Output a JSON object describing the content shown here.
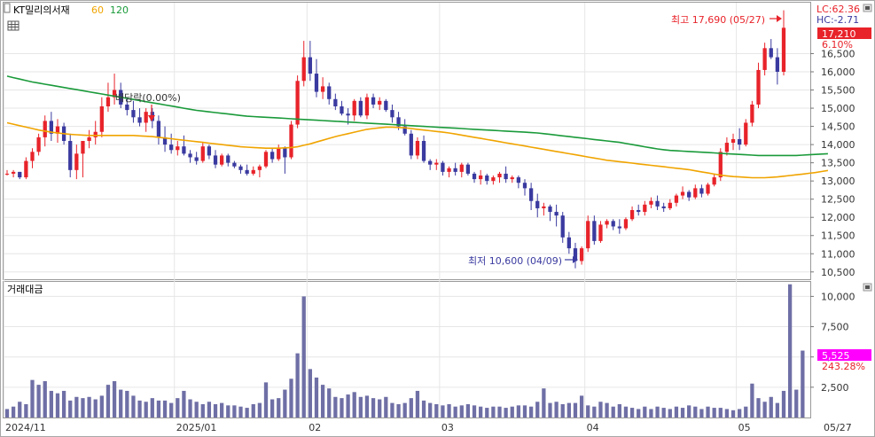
{
  "header": {
    "stock_name": "KT밀리의서재",
    "ma_short_label": "60",
    "ma_long_label": "120",
    "volume_title": "거래대금"
  },
  "indicators": {
    "lc": "LC:62.36",
    "hc": "HC:-2.71",
    "current_price": "17,210",
    "current_change": "6.10%",
    "current_volume": "5,525",
    "volume_change": "243.28%"
  },
  "annotations": {
    "high": "최고 17,690 (05/27)",
    "low": "최저 10,600 (04/09)",
    "dividend": "배당락(0.00%)"
  },
  "colors": {
    "up": "#e8232a",
    "down": "#3a3aa0",
    "ma60": "#f0a400",
    "ma120": "#1a9a3a",
    "volume_bar": "#6f6fa6",
    "price_badge": "#e8232a",
    "volume_badge": "#ff00ff",
    "grid": "#e6e6e6"
  },
  "chart_data": {
    "type": "candlestick",
    "price_axis": {
      "min": 10300,
      "max": 17900,
      "ticks": [
        "10,500",
        "11,000",
        "11,500",
        "12,000",
        "12,500",
        "13,000",
        "13,500",
        "14,000",
        "14,500",
        "15,000",
        "15,500",
        "16,000",
        "16,500"
      ]
    },
    "volume_axis": {
      "min": 0,
      "max": 11200,
      "ticks": [
        "2,500",
        "5,000",
        "7,500",
        "10,000"
      ]
    },
    "x_labels": [
      "2024/11",
      "2025/01",
      "02",
      "03",
      "04",
      "05",
      "05/27"
    ],
    "x_label_index": [
      0,
      27,
      48,
      69,
      92,
      116,
      130
    ],
    "candles": [
      [
        13200,
        13300,
        13150,
        13200
      ],
      [
        13200,
        13300,
        13100,
        13250
      ],
      [
        13250,
        13250,
        13050,
        13100
      ],
      [
        13100,
        13650,
        13050,
        13550
      ],
      [
        13550,
        13900,
        13350,
        13800
      ],
      [
        13800,
        14300,
        13700,
        14200
      ],
      [
        14200,
        14800,
        13950,
        14650
      ],
      [
        14650,
        14900,
        14100,
        14300
      ],
      [
        14300,
        14700,
        14050,
        14500
      ],
      [
        14500,
        14600,
        14000,
        14100
      ],
      [
        14100,
        14300,
        13100,
        13300
      ],
      [
        13300,
        14000,
        13050,
        13750
      ],
      [
        13750,
        14000,
        13100,
        14100
      ],
      [
        14100,
        14400,
        13900,
        14200
      ],
      [
        14200,
        14650,
        14000,
        14350
      ],
      [
        14350,
        15300,
        14200,
        15050
      ],
      [
        15050,
        15700,
        14900,
        15300
      ],
      [
        15300,
        15950,
        15100,
        15500
      ],
      [
        15500,
        15700,
        15000,
        15100
      ],
      [
        15100,
        15300,
        14800,
        14950
      ],
      [
        14950,
        15200,
        14600,
        14750
      ],
      [
        14750,
        15000,
        14500,
        14600
      ],
      [
        14600,
        15000,
        14350,
        14900
      ],
      [
        14900,
        15000,
        14450,
        14650
      ],
      [
        14650,
        14800,
        14000,
        14200
      ],
      [
        14200,
        14500,
        13800,
        14000
      ],
      [
        14000,
        14300,
        13750,
        13850
      ],
      [
        13850,
        14100,
        13700,
        13950
      ],
      [
        13950,
        14250,
        13700,
        13750
      ],
      [
        13750,
        13850,
        13500,
        13650
      ],
      [
        13650,
        13800,
        13450,
        13550
      ],
      [
        13550,
        14050,
        13500,
        13950
      ],
      [
        13950,
        14000,
        13600,
        13700
      ],
      [
        13700,
        13850,
        13350,
        13450
      ],
      [
        13450,
        13750,
        13400,
        13700
      ],
      [
        13700,
        13750,
        13400,
        13500
      ],
      [
        13500,
        13550,
        13350,
        13400
      ],
      [
        13400,
        13450,
        13200,
        13300
      ],
      [
        13300,
        13450,
        13150,
        13200
      ],
      [
        13200,
        13400,
        13150,
        13300
      ],
      [
        13300,
        13450,
        13100,
        13400
      ],
      [
        13400,
        13850,
        13350,
        13800
      ],
      [
        13800,
        13900,
        13500,
        13600
      ],
      [
        13600,
        14000,
        13550,
        13900
      ],
      [
        13900,
        13950,
        13200,
        13650
      ],
      [
        13650,
        14650,
        13600,
        14550
      ],
      [
        14550,
        15900,
        14450,
        15750
      ],
      [
        15750,
        16850,
        15600,
        16400
      ],
      [
        16400,
        16850,
        15750,
        15950
      ],
      [
        15950,
        16350,
        15300,
        15450
      ],
      [
        15450,
        15850,
        15250,
        15600
      ],
      [
        15600,
        15700,
        15100,
        15250
      ],
      [
        15250,
        15400,
        14950,
        15050
      ],
      [
        15050,
        15200,
        14800,
        14850
      ],
      [
        14850,
        15000,
        14550,
        14800
      ],
      [
        14800,
        15250,
        14650,
        15200
      ],
      [
        15200,
        15300,
        14750,
        14800
      ],
      [
        14800,
        15400,
        14700,
        15300
      ],
      [
        15300,
        15400,
        15000,
        15100
      ],
      [
        15100,
        15300,
        14950,
        15200
      ],
      [
        15200,
        15250,
        14900,
        14950
      ],
      [
        14950,
        15100,
        14600,
        14750
      ],
      [
        14750,
        14900,
        14400,
        14500
      ],
      [
        14500,
        14700,
        14250,
        14300
      ],
      [
        14300,
        14400,
        13600,
        13700
      ],
      [
        13700,
        14200,
        13600,
        14100
      ],
      [
        14100,
        14250,
        13500,
        13550
      ],
      [
        13550,
        13600,
        13300,
        13450
      ],
      [
        13450,
        13600,
        13300,
        13500
      ],
      [
        13500,
        13550,
        13150,
        13250
      ],
      [
        13250,
        13400,
        13100,
        13350
      ],
      [
        13350,
        13500,
        13150,
        13250
      ],
      [
        13250,
        13500,
        13100,
        13450
      ],
      [
        13450,
        13500,
        13150,
        13200
      ],
      [
        13200,
        13250,
        12950,
        13050
      ],
      [
        13050,
        13300,
        12900,
        13150
      ],
      [
        13150,
        13200,
        12900,
        13000
      ],
      [
        13000,
        13150,
        12900,
        13100
      ],
      [
        13100,
        13250,
        12950,
        13200
      ],
      [
        13200,
        13400,
        12950,
        13050
      ],
      [
        13050,
        13150,
        12950,
        13100
      ],
      [
        13100,
        13150,
        12800,
        12950
      ],
      [
        12950,
        13050,
        12600,
        12800
      ],
      [
        12800,
        12950,
        12200,
        12450
      ],
      [
        12450,
        12650,
        12000,
        12250
      ],
      [
        12250,
        12400,
        12050,
        12300
      ],
      [
        12300,
        12350,
        11900,
        12150
      ],
      [
        12150,
        12350,
        11750,
        12050
      ],
      [
        12050,
        12150,
        11300,
        11450
      ],
      [
        11450,
        11600,
        11000,
        11150
      ],
      [
        11150,
        11300,
        10600,
        10800
      ],
      [
        10800,
        11200,
        10700,
        11150
      ],
      [
        11150,
        12050,
        11050,
        11900
      ],
      [
        11900,
        12050,
        11250,
        11350
      ],
      [
        11350,
        11900,
        11300,
        11800
      ],
      [
        11800,
        11950,
        11700,
        11900
      ],
      [
        11900,
        11950,
        11650,
        11750
      ],
      [
        11750,
        11950,
        11550,
        11700
      ],
      [
        11700,
        12000,
        11650,
        11950
      ],
      [
        11950,
        12300,
        11900,
        12200
      ],
      [
        12200,
        12350,
        12050,
        12150
      ],
      [
        12150,
        12450,
        12050,
        12350
      ],
      [
        12350,
        12550,
        12250,
        12450
      ],
      [
        12450,
        12600,
        12200,
        12300
      ],
      [
        12300,
        12400,
        12150,
        12250
      ],
      [
        12250,
        12500,
        12200,
        12400
      ],
      [
        12400,
        12650,
        12300,
        12600
      ],
      [
        12600,
        12850,
        12500,
        12700
      ],
      [
        12700,
        12750,
        12450,
        12550
      ],
      [
        12550,
        12900,
        12500,
        12800
      ],
      [
        12800,
        12900,
        12550,
        12650
      ],
      [
        12650,
        12950,
        12600,
        12900
      ],
      [
        12900,
        13200,
        12850,
        13100
      ],
      [
        13100,
        13900,
        13000,
        13800
      ],
      [
        13800,
        14200,
        13700,
        14050
      ],
      [
        14050,
        14300,
        13850,
        14150
      ],
      [
        14150,
        14450,
        13850,
        14000
      ],
      [
        14000,
        14700,
        13950,
        14600
      ],
      [
        14600,
        15200,
        14500,
        15100
      ],
      [
        15100,
        16250,
        15000,
        16050
      ],
      [
        16050,
        16800,
        15900,
        16650
      ],
      [
        16650,
        16900,
        16350,
        16400
      ],
      [
        16400,
        16650,
        15650,
        16000
      ],
      [
        16000,
        17690,
        15900,
        17210
      ]
    ],
    "ma60": [
      14600,
      14560,
      14520,
      14480,
      14440,
      14400,
      14370,
      14340,
      14320,
      14300,
      14280,
      14270,
      14260,
      14250,
      14250,
      14250,
      14250,
      14250,
      14250,
      14250,
      14250,
      14240,
      14230,
      14220,
      14200,
      14180,
      14160,
      14140,
      14120,
      14100,
      14080,
      14060,
      14040,
      14020,
      14000,
      13980,
      13960,
      13940,
      13930,
      13920,
      13910,
      13900,
      13900,
      13900,
      13910,
      13920,
      13940,
      13980,
      14020,
      14070,
      14120,
      14170,
      14220,
      14260,
      14300,
      14340,
      14380,
      14420,
      14440,
      14460,
      14480,
      14480,
      14470,
      14460,
      14440,
      14420,
      14400,
      14380,
      14360,
      14340,
      14320,
      14290,
      14260,
      14230,
      14200,
      14170,
      14140,
      14110,
      14080,
      14050,
      14020,
      13990,
      13960,
      13930,
      13900,
      13870,
      13840,
      13810,
      13780,
      13750,
      13720,
      13690,
      13660,
      13630,
      13600,
      13570,
      13550,
      13530,
      13510,
      13490,
      13470,
      13450,
      13430,
      13410,
      13390,
      13370,
      13350,
      13330,
      13310,
      13280,
      13250,
      13220,
      13190,
      13160,
      13140,
      13120,
      13110,
      13100,
      13090,
      13090,
      13090,
      13100,
      13110,
      13130,
      13150,
      13170,
      13190,
      13210,
      13230,
      13260,
      13290
    ],
    "ma120": [
      15880,
      15840,
      15800,
      15760,
      15720,
      15690,
      15660,
      15630,
      15600,
      15570,
      15540,
      15510,
      15480,
      15450,
      15420,
      15390,
      15360,
      15330,
      15300,
      15270,
      15240,
      15210,
      15180,
      15150,
      15120,
      15090,
      15060,
      15030,
      15000,
      14970,
      14940,
      14920,
      14900,
      14880,
      14860,
      14840,
      14820,
      14800,
      14780,
      14770,
      14760,
      14750,
      14740,
      14730,
      14720,
      14710,
      14700,
      14690,
      14680,
      14670,
      14660,
      14650,
      14640,
      14630,
      14620,
      14610,
      14600,
      14590,
      14580,
      14570,
      14560,
      14550,
      14540,
      14530,
      14520,
      14510,
      14500,
      14490,
      14480,
      14470,
      14460,
      14450,
      14440,
      14430,
      14420,
      14410,
      14400,
      14390,
      14380,
      14370,
      14360,
      14350,
      14340,
      14330,
      14320,
      14300,
      14280,
      14260,
      14240,
      14220,
      14200,
      14180,
      14160,
      14140,
      14120,
      14100,
      14080,
      14060,
      14030,
      14000,
      13970,
      13940,
      13910,
      13880,
      13860,
      13840,
      13830,
      13820,
      13810,
      13800,
      13790,
      13780,
      13770,
      13760,
      13750,
      13740,
      13730,
      13720,
      13710,
      13700,
      13700,
      13700,
      13700,
      13700,
      13700,
      13700,
      13710,
      13720,
      13730,
      13740,
      13750
    ],
    "volume": [
      700,
      900,
      1300,
      1100,
      3100,
      2700,
      3000,
      2200,
      2000,
      2200,
      1400,
      1700,
      1600,
      1700,
      1500,
      1800,
      2700,
      3000,
      2300,
      2200,
      1800,
      1400,
      1300,
      1600,
      1400,
      1400,
      1200,
      1600,
      2200,
      1500,
      1300,
      1100,
      1300,
      1100,
      1200,
      1000,
      1000,
      900,
      800,
      1100,
      1200,
      2900,
      1500,
      1600,
      2300,
      3200,
      5300,
      10000,
      4000,
      3300,
      2700,
      2400,
      1700,
      1600,
      1900,
      2100,
      1700,
      1800,
      1600,
      1500,
      1700,
      1200,
      1100,
      1200,
      1600,
      2200,
      1400,
      1200,
      1100,
      1000,
      1100,
      900,
      1000,
      1100,
      1000,
      900,
      800,
      900,
      900,
      800,
      900,
      1000,
      1000,
      900,
      1300,
      2400,
      1200,
      1300,
      1100,
      1200,
      1200,
      1800,
      1000,
      900,
      1300,
      1200,
      900,
      1100,
      900,
      800,
      700,
      900,
      700,
      900,
      800,
      700,
      900,
      800,
      1000,
      900,
      700,
      900,
      800,
      800,
      700,
      600,
      700,
      900,
      2800,
      1600,
      1300,
      1700,
      1200,
      2200,
      11000,
      2300,
      5525
    ],
    "dividend_index": 23,
    "low_index": 92,
    "high_index": 130
  }
}
